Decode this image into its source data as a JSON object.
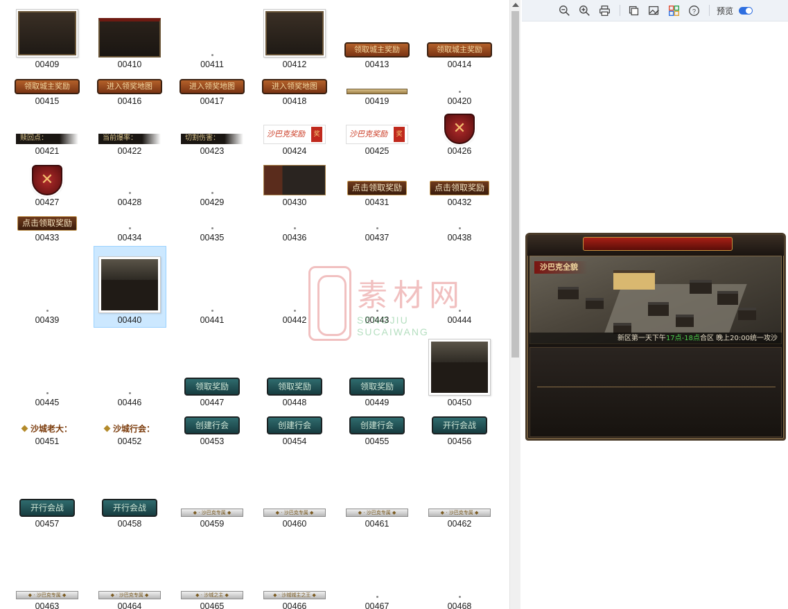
{
  "grid": {
    "items": [
      {
        "name": "00409",
        "kind": "frame"
      },
      {
        "name": "00410",
        "kind": "dark"
      },
      {
        "name": "00411",
        "kind": "dot"
      },
      {
        "name": "00412",
        "kind": "frame"
      },
      {
        "name": "00413",
        "kind": "btn-orange",
        "text": "领取城主奖励"
      },
      {
        "name": "00414",
        "kind": "btn-orange",
        "text": "领取城主奖励"
      },
      {
        "name": "00415",
        "kind": "btn-orange",
        "text": "领取城主奖励"
      },
      {
        "name": "00416",
        "kind": "btn-orange",
        "text": "进入领奖地图"
      },
      {
        "name": "00417",
        "kind": "btn-orange",
        "text": "进入领奖地图"
      },
      {
        "name": "00418",
        "kind": "btn-orange",
        "text": "进入领奖地图"
      },
      {
        "name": "00419",
        "kind": "bar"
      },
      {
        "name": "00420",
        "kind": "dot"
      },
      {
        "name": "00421",
        "kind": "label-dark",
        "text": "赎回点："
      },
      {
        "name": "00422",
        "kind": "label-dark",
        "text": "当前爆率："
      },
      {
        "name": "00423",
        "kind": "label-dark",
        "text": "切割伤害："
      },
      {
        "name": "00424",
        "kind": "red-title",
        "text": "沙巴克奖励",
        "badge": "奖"
      },
      {
        "name": "00425",
        "kind": "red-title",
        "text": "沙巴克奖励",
        "badge": "奖"
      },
      {
        "name": "00426",
        "kind": "shield"
      },
      {
        "name": "00427",
        "kind": "shield"
      },
      {
        "name": "00428",
        "kind": "dot"
      },
      {
        "name": "00429",
        "kind": "dot"
      },
      {
        "name": "00430",
        "kind": "portrait"
      },
      {
        "name": "00431",
        "kind": "btn-brown",
        "text": "点击领取奖励"
      },
      {
        "name": "00432",
        "kind": "btn-brown",
        "text": "点击领取奖励"
      },
      {
        "name": "00433",
        "kind": "btn-brown",
        "text": "点击领取奖励"
      },
      {
        "name": "00434",
        "kind": "dot"
      },
      {
        "name": "00435",
        "kind": "dot"
      },
      {
        "name": "00436",
        "kind": "dot"
      },
      {
        "name": "00437",
        "kind": "dot"
      },
      {
        "name": "00438",
        "kind": "dot"
      },
      {
        "name": "00439",
        "kind": "dot"
      },
      {
        "name": "00440",
        "kind": "shot",
        "selected": true
      },
      {
        "name": "00441",
        "kind": "dot"
      },
      {
        "name": "00442",
        "kind": "dot"
      },
      {
        "name": "00443",
        "kind": "dot"
      },
      {
        "name": "00444",
        "kind": "dot"
      },
      {
        "name": "00445",
        "kind": "dot"
      },
      {
        "name": "00446",
        "kind": "dot"
      },
      {
        "name": "00447",
        "kind": "btn-teal",
        "text": "领取奖励"
      },
      {
        "name": "00448",
        "kind": "btn-teal",
        "text": "领取奖励"
      },
      {
        "name": "00449",
        "kind": "btn-teal",
        "text": "领取奖励"
      },
      {
        "name": "00450",
        "kind": "shot"
      },
      {
        "name": "00451",
        "kind": "gold-tag",
        "text": "沙城老大："
      },
      {
        "name": "00452",
        "kind": "gold-tag",
        "text": "沙城行会："
      },
      {
        "name": "00453",
        "kind": "btn-teal",
        "text": "创建行会"
      },
      {
        "name": "00454",
        "kind": "btn-teal",
        "text": "创建行会"
      },
      {
        "name": "00455",
        "kind": "btn-teal",
        "text": "创建行会"
      },
      {
        "name": "00456",
        "kind": "btn-teal",
        "text": "开行会战"
      },
      {
        "name": "00457",
        "kind": "btn-teal",
        "text": "开行会战"
      },
      {
        "name": "00458",
        "kind": "btn-teal",
        "text": "开行会战"
      },
      {
        "name": "00459",
        "kind": "silver",
        "text": "◆ · 沙巴克专属 ◆"
      },
      {
        "name": "00460",
        "kind": "silver",
        "text": "◆ · 沙巴克专属 ◆"
      },
      {
        "name": "00461",
        "kind": "silver",
        "text": "◆ · 沙巴克专属 ◆"
      },
      {
        "name": "00462",
        "kind": "silver",
        "text": "◆ · 沙巴克专属 ◆"
      },
      {
        "name": "00463",
        "kind": "silver",
        "text": "◆ · 沙巴克专属 ◆"
      },
      {
        "name": "00464",
        "kind": "silver",
        "text": "◆ · 沙巴克专属 ◆"
      },
      {
        "name": "00465",
        "kind": "silver",
        "text": "◆ · 沙城之主 ◆"
      },
      {
        "name": "00466",
        "kind": "silver",
        "text": "◆ · 沙城城主之王 ◆"
      },
      {
        "name": "00467",
        "kind": "dot"
      },
      {
        "name": "00468",
        "kind": "dot"
      }
    ]
  },
  "toolbar": {
    "icons": [
      "zoom-out-icon",
      "zoom-in-icon",
      "print-icon",
      "copy-icon",
      "edit-image-icon",
      "apps-icon",
      "help-icon"
    ],
    "preview_label": "预览",
    "accent": "#2f6fe0"
  },
  "preview": {
    "scene_title": "沙巴克全貌",
    "info_prefix": "新区第一天下午",
    "info_highlight": "17点-18点",
    "info_suffix": "合区   晚上20:00统一攻沙"
  },
  "watermark": {
    "big_text": "素材网",
    "line1": "SENGJIU",
    "line2": "SUCAIWANG"
  }
}
